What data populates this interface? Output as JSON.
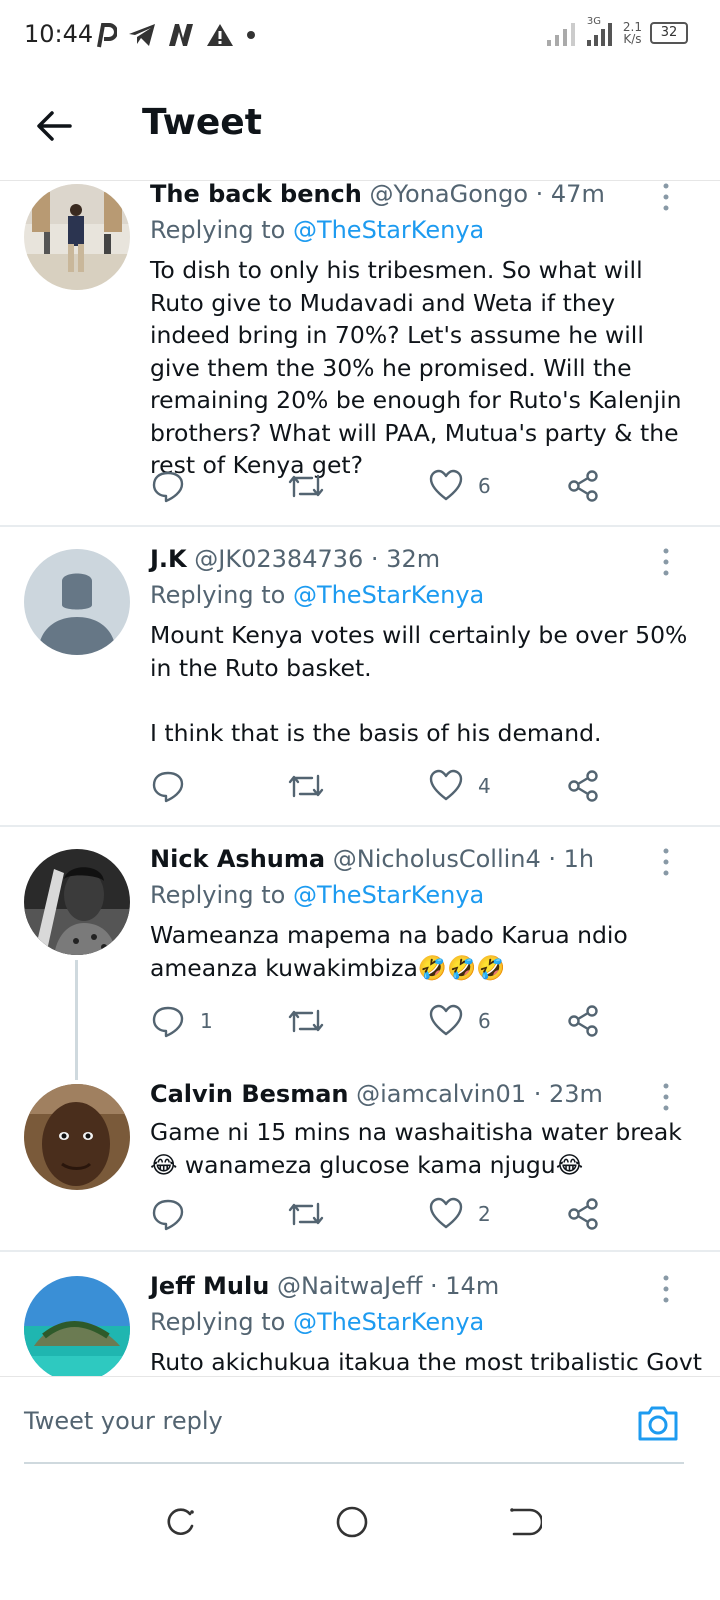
{
  "status_bar": {
    "time": "10:44",
    "network_type": "3G",
    "speed_value": "2.1",
    "speed_unit": "K/s",
    "battery": "32"
  },
  "header": {
    "title": "Tweet"
  },
  "tweets": [
    {
      "name": "The back bench",
      "handle": "@YonaGongo",
      "time": "· 47m",
      "replying_prefix": "Replying to ",
      "replying_to": "@TheStarKenya",
      "text": "To dish to only his tribesmen. So what will Ruto give to Mudavadi and Weta if they indeed bring in 70%? Let's assume he will give them the 30% he promised. Will the remaining 20% be enough for Ruto's Kalenjin brothers? What will PAA, Mutua's party & the rest of Kenya get?",
      "replies": "",
      "likes": "6"
    },
    {
      "name": "J.K",
      "handle": "@JK02384736",
      "time": "· 32m",
      "replying_prefix": "Replying to ",
      "replying_to": "@TheStarKenya",
      "text": "Mount Kenya votes will certainly be over 50% in the Ruto basket.\n\nI think that is the basis of his demand.",
      "replies": "",
      "likes": "4"
    },
    {
      "name": "Nick Ashuma",
      "handle": "@NicholusCollin4",
      "time": "· 1h",
      "replying_prefix": "Replying to ",
      "replying_to": "@TheStarKenya",
      "text": "Wameanza mapema na bado Karua ndio ameanza kuwakimbiza🤣🤣🤣",
      "replies": "1",
      "likes": "6"
    },
    {
      "name": "Calvin Besman",
      "handle": "@iamcalvin01",
      "time": "· 23m",
      "text": "Game ni 15 mins na washaitisha water break😂 wanameza glucose kama njugu😂",
      "replies": "",
      "likes": "2"
    },
    {
      "name": "Jeff Mulu",
      "handle": "@NaitwaJeff",
      "time": "· 14m",
      "replying_prefix": "Replying to ",
      "replying_to": "@TheStarKenya",
      "text": "Ruto akichukua itakua the most tribalistic Govt"
    }
  ],
  "reply_bar": {
    "placeholder": "Tweet your reply"
  },
  "colors": {
    "accent": "#1d9bf0",
    "secondary_text": "#536471",
    "primary_text": "#0f1419"
  }
}
